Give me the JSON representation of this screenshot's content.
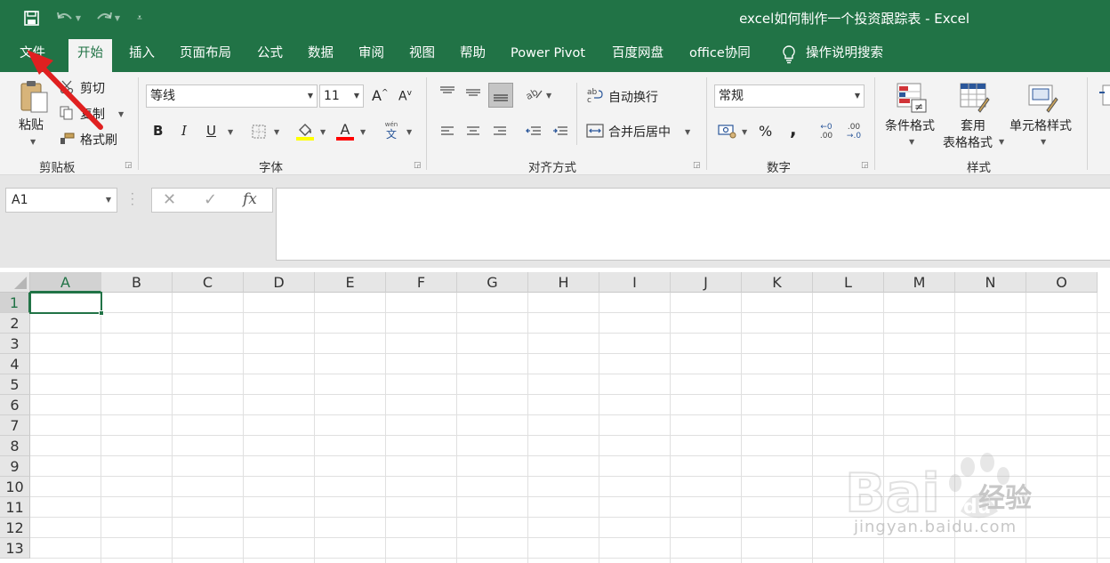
{
  "app": {
    "title": "excel如何制作一个投资跟踪表 - Excel",
    "accent_color": "#217346"
  },
  "quick_access": {
    "save_icon": "save-icon",
    "undo_icon": "undo-icon",
    "redo_icon": "redo-icon",
    "customize_icon": "customize-qat-icon"
  },
  "tabs": [
    {
      "label": "文件"
    },
    {
      "label": "开始"
    },
    {
      "label": "插入"
    },
    {
      "label": "页面布局"
    },
    {
      "label": "公式"
    },
    {
      "label": "数据"
    },
    {
      "label": "审阅"
    },
    {
      "label": "视图"
    },
    {
      "label": "帮助"
    },
    {
      "label": "Power Pivot"
    },
    {
      "label": "百度网盘"
    },
    {
      "label": "office协同"
    }
  ],
  "active_tab": "开始",
  "tell_me": {
    "label": "操作说明搜索"
  },
  "ribbon": {
    "clipboard": {
      "group_label": "剪贴板",
      "paste": "粘贴",
      "cut": "剪切",
      "copy": "复制",
      "format_painter": "格式刷"
    },
    "font": {
      "group_label": "字体",
      "font_name": "等线",
      "font_size": "11",
      "increase_size": "A",
      "decrease_size": "A",
      "bold": "B",
      "italic": "I",
      "underline": "U",
      "font_color_letter": "A",
      "phonetic": "文",
      "phonetic_small": "wén",
      "fill_color": "#ffff00",
      "text_color": "#ff0000"
    },
    "alignment": {
      "group_label": "对齐方式",
      "wrap_text": "自动换行",
      "merge_center": "合并后居中"
    },
    "number": {
      "group_label": "数字",
      "format": "常规",
      "percent": "%",
      "comma": ",",
      "inc_decimal_top": "←0",
      "inc_decimal_bottom": ".00",
      "dec_decimal_top": ".00",
      "dec_decimal_bottom": "→.0"
    },
    "styles": {
      "group_label": "样式",
      "conditional_format": "条件格式",
      "table_format_line1": "套用",
      "table_format_line2": "表格格式",
      "cell_styles": "单元格样式"
    }
  },
  "formula_bar": {
    "name_box": "A1",
    "cancel": "✕",
    "enter": "✓",
    "fx": "fx",
    "value": ""
  },
  "grid": {
    "columns": [
      "A",
      "B",
      "C",
      "D",
      "E",
      "F",
      "G",
      "H",
      "I",
      "J",
      "K",
      "L",
      "M",
      "N",
      "O"
    ],
    "rows": [
      "1",
      "2",
      "3",
      "4",
      "5",
      "6",
      "7",
      "8",
      "9",
      "10",
      "11",
      "12",
      "13"
    ],
    "selected_cell": "A1"
  },
  "watermark": {
    "brand": "经验",
    "url": "jingyan.baidu.com"
  }
}
